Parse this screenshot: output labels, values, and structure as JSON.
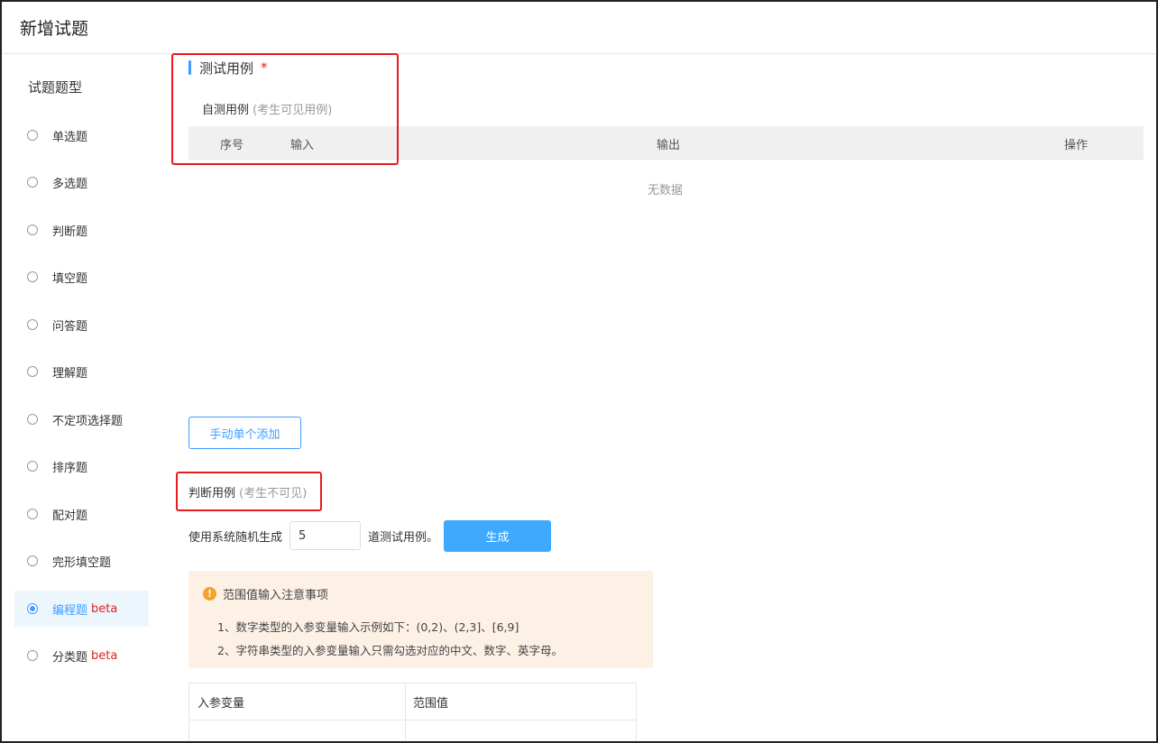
{
  "header": {
    "title": "新增试题"
  },
  "sidebar": {
    "title": "试题题型",
    "items": [
      {
        "label": "单选题",
        "badge": ""
      },
      {
        "label": "多选题",
        "badge": ""
      },
      {
        "label": "判断题",
        "badge": ""
      },
      {
        "label": "填空题",
        "badge": ""
      },
      {
        "label": "问答题",
        "badge": ""
      },
      {
        "label": "理解题",
        "badge": ""
      },
      {
        "label": "不定项选择题",
        "badge": ""
      },
      {
        "label": "排序题",
        "badge": ""
      },
      {
        "label": "配对题",
        "badge": ""
      },
      {
        "label": "完形填空题",
        "badge": ""
      },
      {
        "label": "编程题",
        "badge": "beta",
        "selected": true
      },
      {
        "label": "分类题",
        "badge": "beta"
      }
    ]
  },
  "test_cases": {
    "title": "测试用例",
    "required_mark": "*",
    "self_test_label": "自测用例",
    "self_test_hint": "(考生可见用例)",
    "columns": [
      "序号",
      "输入",
      "输出",
      "操作"
    ],
    "empty_text": "无数据",
    "add_button": "手动单个添加"
  },
  "judge_cases": {
    "label": "判断用例",
    "hint": "(考生不可见)",
    "gen_prefix": "使用系统随机生成",
    "count_value": "5",
    "gen_suffix": "道测试用例。",
    "generate_button": "生成"
  },
  "notice": {
    "title": "范围值输入注意事项",
    "lines": [
      "1、数字类型的入参变量输入示例如下：(0,2)、(2,3]、[6,9]",
      "2、字符串类型的入参变量输入只需勾选对应的中文、数字、英字母。"
    ]
  },
  "var_table": {
    "columns": [
      "入参变量",
      "范围值"
    ]
  },
  "colors": {
    "accent": "#409eff",
    "primary_button": "#3ea9fd",
    "highlight": "#e8191f",
    "warning": "#f5a12a"
  }
}
